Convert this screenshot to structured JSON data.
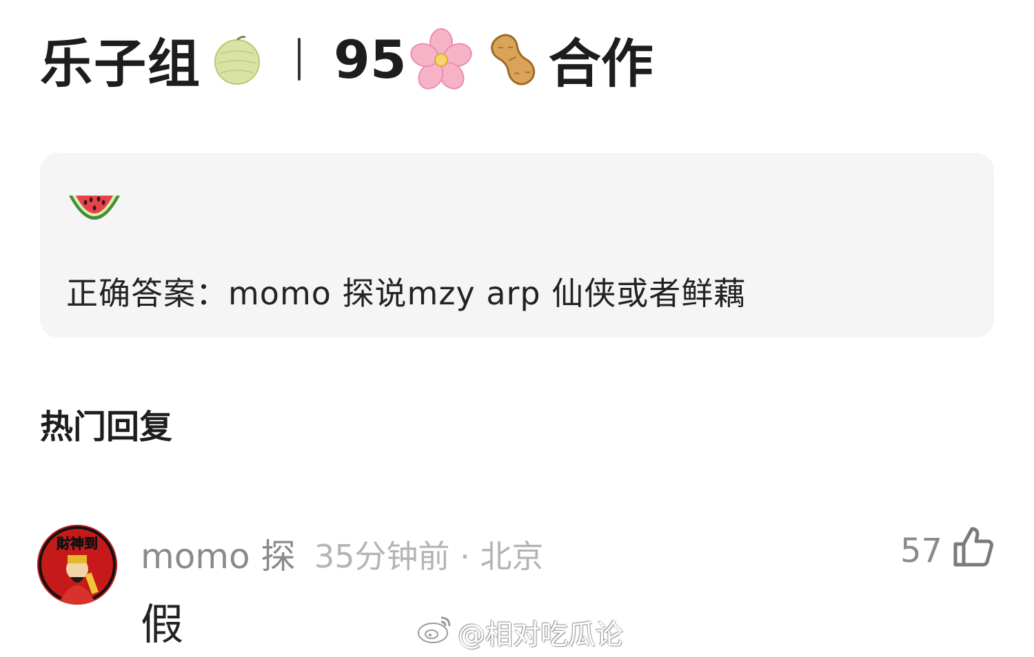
{
  "post": {
    "title_left": "乐子组",
    "title_number": "95",
    "title_right": "合作",
    "title_icons": [
      "melon-icon",
      "cherry-blossom-icon",
      "peanut-icon"
    ]
  },
  "answer_card": {
    "icon": "watermelon-icon",
    "text": "正确答案：momo 探说mzy arp 仙侠或者鲜藕"
  },
  "replies": {
    "header": "热门回复",
    "items": [
      {
        "username": "momo 探",
        "meta": "35分钟前 · 北京",
        "text": "假",
        "like_count": "57",
        "avatar_text": "財神到"
      }
    ]
  },
  "watermark": {
    "text": "@相对吃瓜论",
    "icon": "weibo-logo-icon"
  },
  "colors": {
    "card_bg": "#f5f5f5",
    "meta_gray": "#b4b4b4",
    "username_gray": "#8a8a8a"
  }
}
